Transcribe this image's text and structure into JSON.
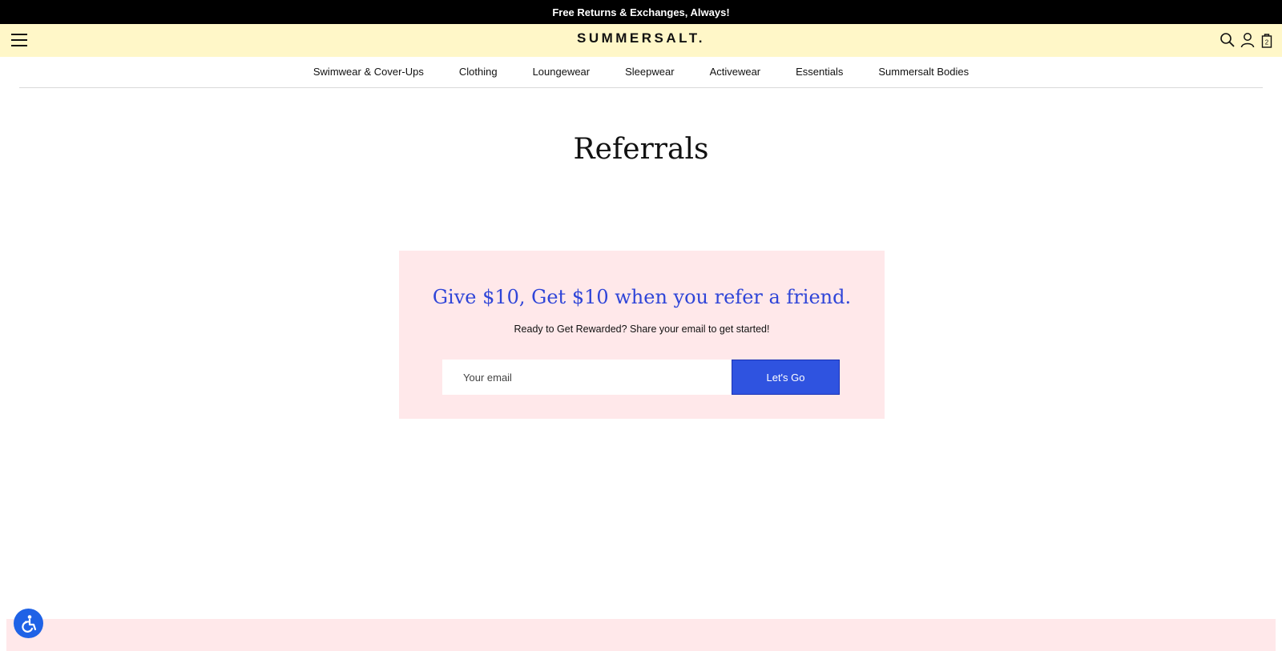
{
  "announcement": {
    "text": "Free Returns & Exchanges, Always!"
  },
  "header": {
    "logo": "SUMMERSALT.",
    "icons": [
      "menu-icon",
      "search-icon",
      "account-icon",
      "bag-icon"
    ],
    "cart_count": "2",
    "background": "#fff7c8"
  },
  "nav": {
    "items": [
      {
        "label": "Swimwear & Cover-Ups"
      },
      {
        "label": "Clothing"
      },
      {
        "label": "Loungewear"
      },
      {
        "label": "Sleepwear"
      },
      {
        "label": "Activewear"
      },
      {
        "label": "Essentials"
      },
      {
        "label": "Summersalt Bodies"
      }
    ]
  },
  "page": {
    "title": "Referrals"
  },
  "referral": {
    "heading": "Give $10, Get $10 when you refer a friend.",
    "subtext": "Ready to Get Rewarded? Share your email to get started!",
    "email_placeholder": "Your email",
    "email_value": "",
    "button_label": "Let's Go",
    "accent_color": "#2f53e0",
    "panel_color": "#ffe8ea"
  },
  "accessibility": {
    "icon": "accessibility-icon",
    "color": "#1f62e6"
  }
}
